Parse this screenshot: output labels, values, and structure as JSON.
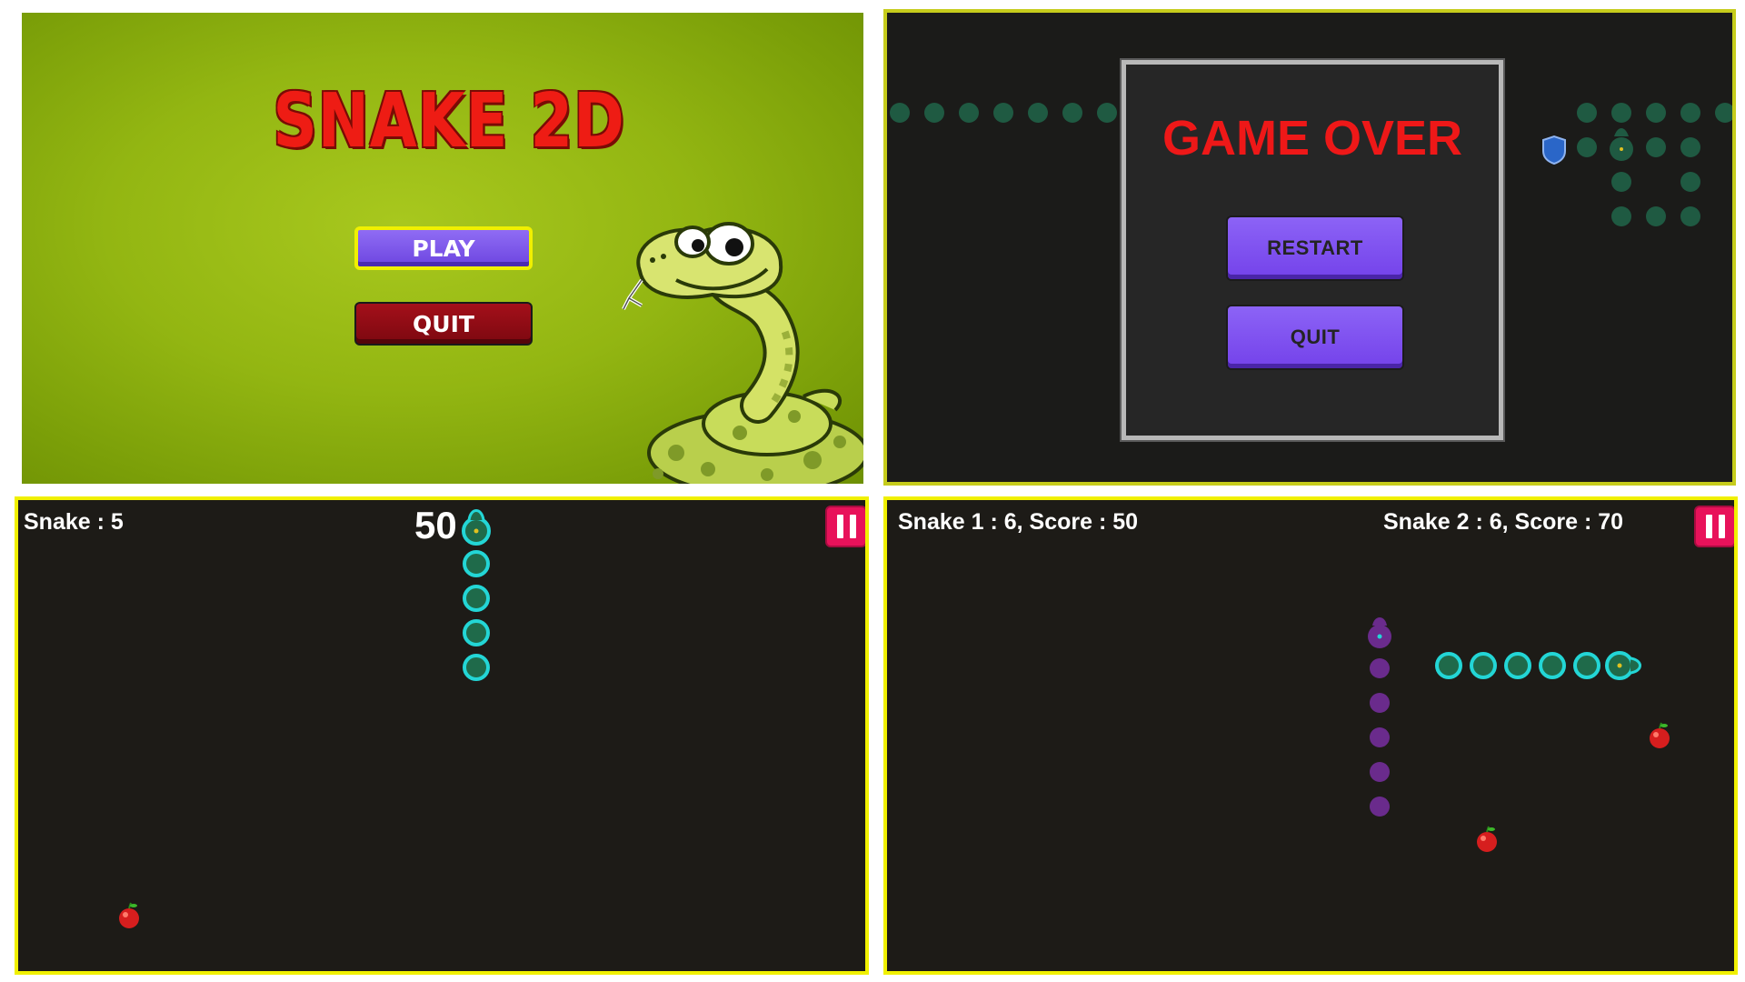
{
  "menu": {
    "title": "SNAKE 2D",
    "play_label": "PLAY",
    "quit_label": "QUIT"
  },
  "game_over": {
    "title": "GAME OVER",
    "restart_label": "RESTART",
    "quit_label": "QUIT"
  },
  "single_player": {
    "snake_label": "Snake : 5",
    "score": "50"
  },
  "multi_player": {
    "snake1_label": "Snake 1 : 6, Score : 50",
    "snake2_label": "Snake 2 : 6, Score : 70"
  },
  "icons": {
    "pause": "pause-icon",
    "apple": "apple-icon",
    "shield": "shield-icon"
  },
  "colors": {
    "snake_cyan": "#23d6d6",
    "snake_purple": "#6a2b8c",
    "pause_button": "#e8125a",
    "arena_border": "#f0f000",
    "play_button": "#7b55ea",
    "quit_button": "#8c0a12",
    "game_over_red": "#ee1818"
  }
}
